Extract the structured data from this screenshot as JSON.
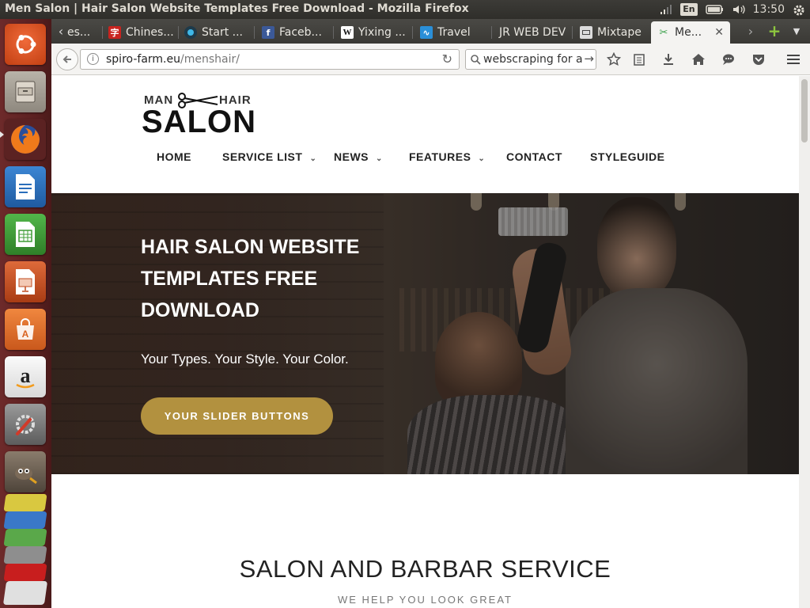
{
  "os": {
    "window_title": "Men Salon | Hair Salon Website Templates Free Download - Mozilla Firefox",
    "keyboard_layout": "En",
    "clock": "13:50"
  },
  "launcher": {
    "items": [
      {
        "name": "ubuntu-dash",
        "icon": "ubuntu-logo-icon",
        "color": "#dd4814"
      },
      {
        "name": "files",
        "icon": "file-cabinet-icon",
        "color": "#a9a39a"
      },
      {
        "name": "firefox",
        "icon": "firefox-icon",
        "color": "#e66000"
      },
      {
        "name": "writer",
        "icon": "writer-doc-icon",
        "color": "#2a6ebb"
      },
      {
        "name": "calc",
        "icon": "calc-sheet-icon",
        "color": "#3e9c35"
      },
      {
        "name": "impress",
        "icon": "impress-slide-icon",
        "color": "#c04b1f"
      },
      {
        "name": "software-center",
        "icon": "shopping-bag-icon",
        "color": "#e07b39"
      },
      {
        "name": "amazon",
        "icon": "amazon-icon",
        "color": "#f2f2f2"
      },
      {
        "name": "system-settings",
        "icon": "settings-wrench-icon",
        "color": "#8a8a8a"
      },
      {
        "name": "gimp",
        "icon": "gimp-icon",
        "color": "#7a6a5a"
      }
    ]
  },
  "browser": {
    "tabs": [
      {
        "label": "es...",
        "favicon": "generic"
      },
      {
        "label": "Chines...",
        "favicon": "chinese-char-icon"
      },
      {
        "label": "Start ...",
        "favicon": "start-icon"
      },
      {
        "label": "Faceb...",
        "favicon": "facebook-icon"
      },
      {
        "label": "Yixing ...",
        "favicon": "wikipedia-icon"
      },
      {
        "label": "Travel",
        "favicon": "travel-icon"
      },
      {
        "label": "JR WEB DEV",
        "favicon": "none"
      },
      {
        "label": "Mixtape",
        "favicon": "mixtape-icon"
      },
      {
        "label": "Me...",
        "favicon": "scissors-icon",
        "active": true
      }
    ],
    "url_domain": "spiro-farm.eu",
    "url_path": "/menshair/",
    "search_query": "webscraping for ar"
  },
  "site": {
    "logo": {
      "top_left": "MAN",
      "top_right": "HAIR",
      "main": "SALON"
    },
    "menu": [
      {
        "label": "HOME",
        "has_dropdown": false
      },
      {
        "label": "SERVICE LIST",
        "has_dropdown": true
      },
      {
        "label": "NEWS",
        "has_dropdown": true
      },
      {
        "label": "FEATURES",
        "has_dropdown": true
      },
      {
        "label": "CONTACT",
        "has_dropdown": false
      },
      {
        "label": "STYLEGUIDE",
        "has_dropdown": false
      }
    ],
    "hero": {
      "headline": "HAIR SALON WEBSITE TEMPLATES FREE DOWNLOAD",
      "tagline": "Your Types. Your Style. Your Color.",
      "cta": "YOUR SLIDER BUTTONS",
      "cta_color": "#b2913f"
    },
    "section": {
      "title": "SALON AND BARBAR SERVICE",
      "subtitle": "WE HELP YOU LOOK GREAT"
    }
  }
}
